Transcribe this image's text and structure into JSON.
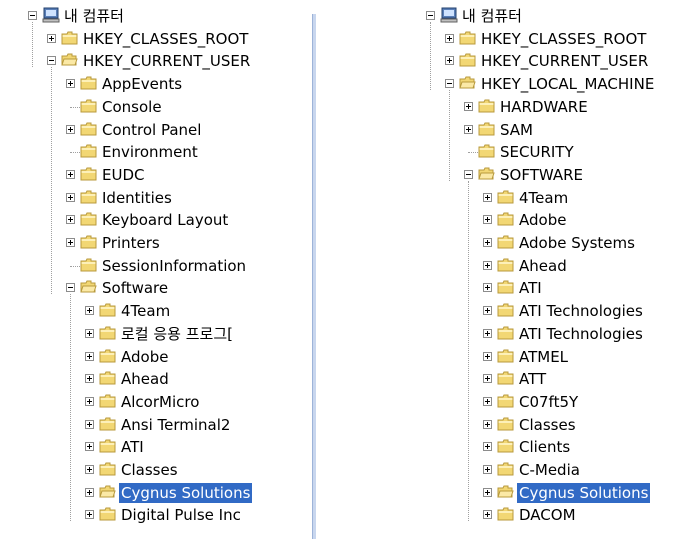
{
  "left_tree": {
    "root": "내 컴퓨터",
    "hives": [
      "HKEY_CLASSES_ROOT",
      "HKEY_CURRENT_USER"
    ],
    "current_user_children": [
      "AppEvents",
      "Console",
      "Control Panel",
      "Environment",
      "EUDC",
      "Identities",
      "Keyboard Layout",
      "Printers",
      "SessionInformation",
      "Software"
    ],
    "software_children": [
      "4Team",
      "로컬 응용 프로그[",
      "Adobe",
      "Ahead",
      "AlcorMicro",
      "Ansi Terminal2",
      "ATI",
      "Classes",
      "Cygnus Solutions",
      "Digital Pulse Inc"
    ]
  },
  "right_tree": {
    "root": "내 컴퓨터",
    "hives": [
      "HKEY_CLASSES_ROOT",
      "HKEY_CURRENT_USER",
      "HKEY_LOCAL_MACHINE"
    ],
    "local_machine_children": [
      "HARDWARE",
      "SAM",
      "SECURITY",
      "SOFTWARE"
    ],
    "software_children": [
      "4Team",
      "Adobe",
      "Adobe Systems",
      "Ahead",
      "ATI",
      "ATI Technologies",
      "ATI Technologies",
      "ATMEL",
      "ATT",
      "C07ft5Y",
      "Classes",
      "Clients",
      "C-Media",
      "Cygnus Solutions",
      "DACOM"
    ]
  },
  "colors": {
    "selection": "#316ac5",
    "folder": "#f2d774",
    "folder_edge": "#b89a3c"
  },
  "icons": {
    "folder": "folder-icon",
    "computer": "computer-icon",
    "expander": "expand-collapse-icon"
  }
}
